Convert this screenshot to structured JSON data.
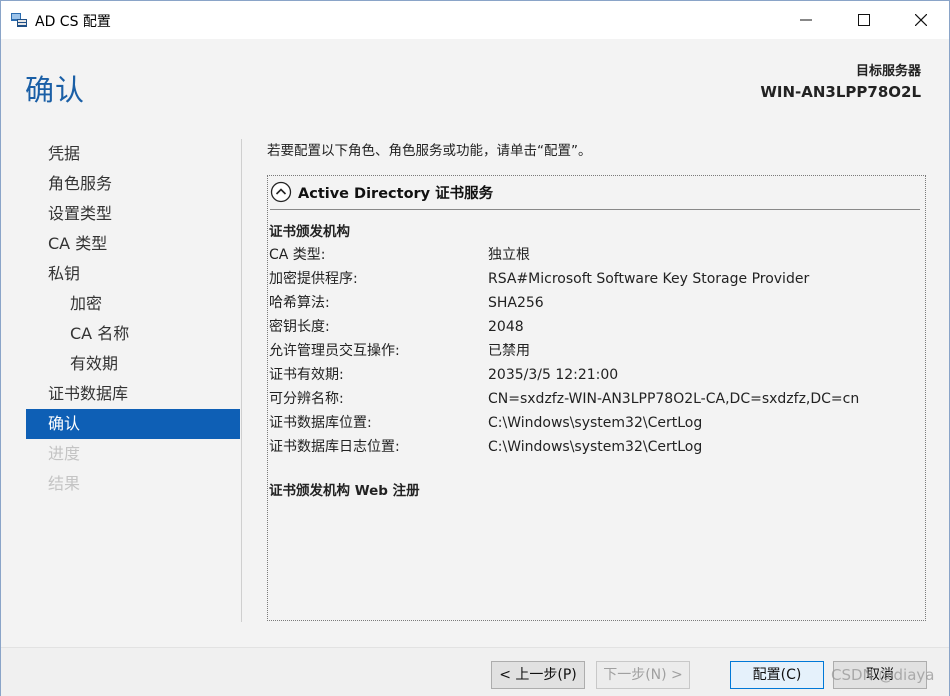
{
  "window": {
    "title": "AD CS 配置"
  },
  "header": {
    "page_title": "确认",
    "target_label": "目标服务器",
    "target_value": "WIN-AN3LPP78O2L"
  },
  "nav": {
    "items": [
      {
        "label": "凭据"
      },
      {
        "label": "角色服务"
      },
      {
        "label": "设置类型"
      },
      {
        "label": "CA 类型"
      },
      {
        "label": "私钥"
      },
      {
        "label": "加密"
      },
      {
        "label": "CA 名称"
      },
      {
        "label": "有效期"
      },
      {
        "label": "证书数据库"
      },
      {
        "label": "确认"
      },
      {
        "label": "进度"
      },
      {
        "label": "结果"
      }
    ]
  },
  "content": {
    "intro": "若要配置以下角色、角色服务或功能，请单击“配置”。",
    "section_title": "Active Directory 证书服务",
    "group1_title": "证书颁发机构",
    "rows": [
      {
        "key": "CA 类型:",
        "value": "独立根"
      },
      {
        "key": "加密提供程序:",
        "value": "RSA#Microsoft Software Key Storage Provider"
      },
      {
        "key": "哈希算法:",
        "value": "SHA256"
      },
      {
        "key": "密钥长度:",
        "value": "2048"
      },
      {
        "key": "允许管理员交互操作:",
        "value": "已禁用"
      },
      {
        "key": "证书有效期:",
        "value": "2035/3/5 12:21:00"
      },
      {
        "key": "可分辨名称:",
        "value": "CN=sxdzfz-WIN-AN3LPP78O2L-CA,DC=sxdzfz,DC=cn"
      },
      {
        "key": "证书数据库位置:",
        "value": "C:\\Windows\\system32\\CertLog"
      },
      {
        "key": "证书数据库日志位置:",
        "value": "C:\\Windows\\system32\\CertLog"
      }
    ],
    "group2_title": "证书颁发机构 Web 注册"
  },
  "footer": {
    "back_label": "< 上一步(P)",
    "next_label": "下一步(N) >",
    "configure_label": "配置(C)",
    "cancel_label": "取消"
  },
  "watermark": "CSDN @diaya",
  "colors": {
    "accent": "#1a5fa6",
    "selected_bg": "#0e5fb5"
  }
}
